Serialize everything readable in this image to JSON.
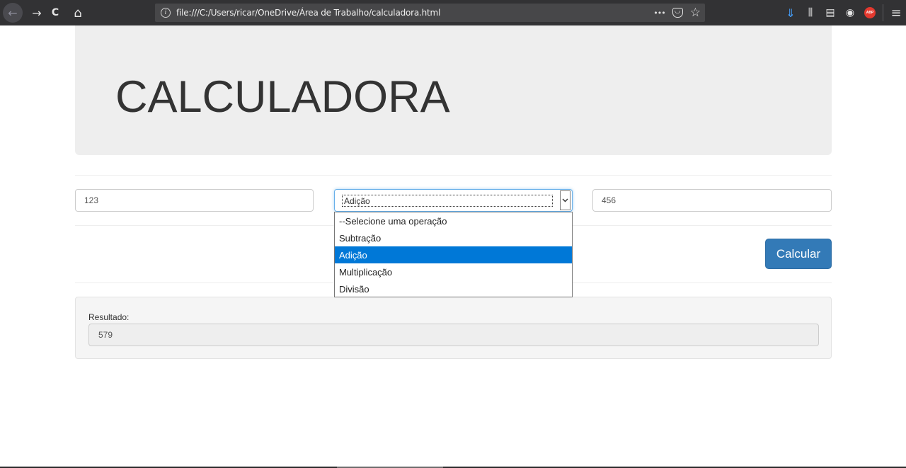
{
  "browser": {
    "url": "file:///C:/Users/ricar/OneDrive/Área de Trabalho/calculadora.html",
    "icons": [
      "back-arrow",
      "forward-arrow",
      "reload",
      "home",
      "info",
      "more-dots",
      "pocket",
      "bookmark-star",
      "download",
      "library",
      "sidebar",
      "account",
      "adblock-plus",
      "menu"
    ],
    "glyphs": {
      "back": "←",
      "forward": "→",
      "reload": "C",
      "home": "⌂",
      "info": "i",
      "more": "•••",
      "pocket": "◡",
      "star": "☆",
      "download": "⇓",
      "library": "⫼",
      "sidebar": "▤",
      "account": "◉",
      "abp": "ABP",
      "menu": "≡"
    }
  },
  "page": {
    "title": "CALCULADORA",
    "input1": {
      "value": "123"
    },
    "input2": {
      "value": "456"
    },
    "operation_select": {
      "selected": "Adição",
      "options": [
        "--Selecione uma operação",
        "Subtração",
        "Adição",
        "Multiplicação",
        "Divisão"
      ],
      "highlighted_index": 2
    },
    "calc_button_label": "Calcular",
    "result_label": "Resultado:",
    "result_value": "579"
  },
  "colors": {
    "primary_button": "#337ab7",
    "highlight": "#0078d7",
    "jumbotron_bg": "#eeeeee"
  }
}
